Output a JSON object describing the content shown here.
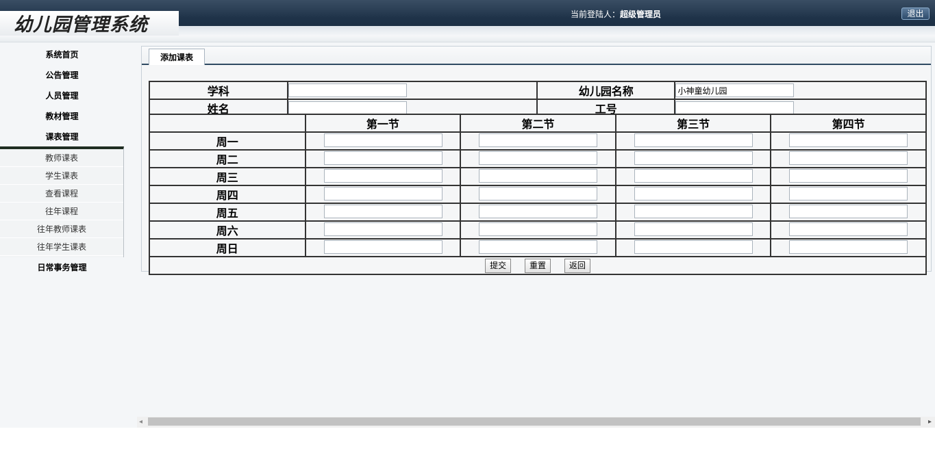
{
  "header": {
    "logo_text": "幼儿园管理系统",
    "login_label": "当前登陆人：",
    "login_user": "超级管理员",
    "logout_label": "退出"
  },
  "sidebar": {
    "items": [
      {
        "label": "系统首页"
      },
      {
        "label": "公告管理"
      },
      {
        "label": "人员管理"
      },
      {
        "label": "教材管理"
      },
      {
        "label": "课表管理"
      }
    ],
    "submenu": [
      {
        "label": "教师课表"
      },
      {
        "label": "学生课表"
      },
      {
        "label": "查看课程"
      },
      {
        "label": "往年课程"
      },
      {
        "label": "往年教师课表"
      },
      {
        "label": "往年学生课表"
      }
    ],
    "bottom_item": {
      "label": "日常事务管理"
    }
  },
  "panel": {
    "tab_label": "添加课表"
  },
  "form": {
    "subject_label": "学科",
    "subject_value": "",
    "kindergarten_label": "幼儿园名称",
    "kindergarten_value": "小神童幼儿园",
    "name_label": "姓名",
    "name_value": "",
    "id_label": "工号",
    "id_value": ""
  },
  "schedule": {
    "periods": [
      "第一节",
      "第二节",
      "第三节",
      "第四节"
    ],
    "days": [
      "周一",
      "周二",
      "周三",
      "周四",
      "周五",
      "周六",
      "周日"
    ]
  },
  "actions": {
    "submit_label": "提交",
    "reset_label": "重置",
    "back_label": "返回"
  },
  "colors": {
    "header_bg": "#1f3349",
    "tab_border": "#2f4a62",
    "panel_bg": "#f5f6f7"
  }
}
